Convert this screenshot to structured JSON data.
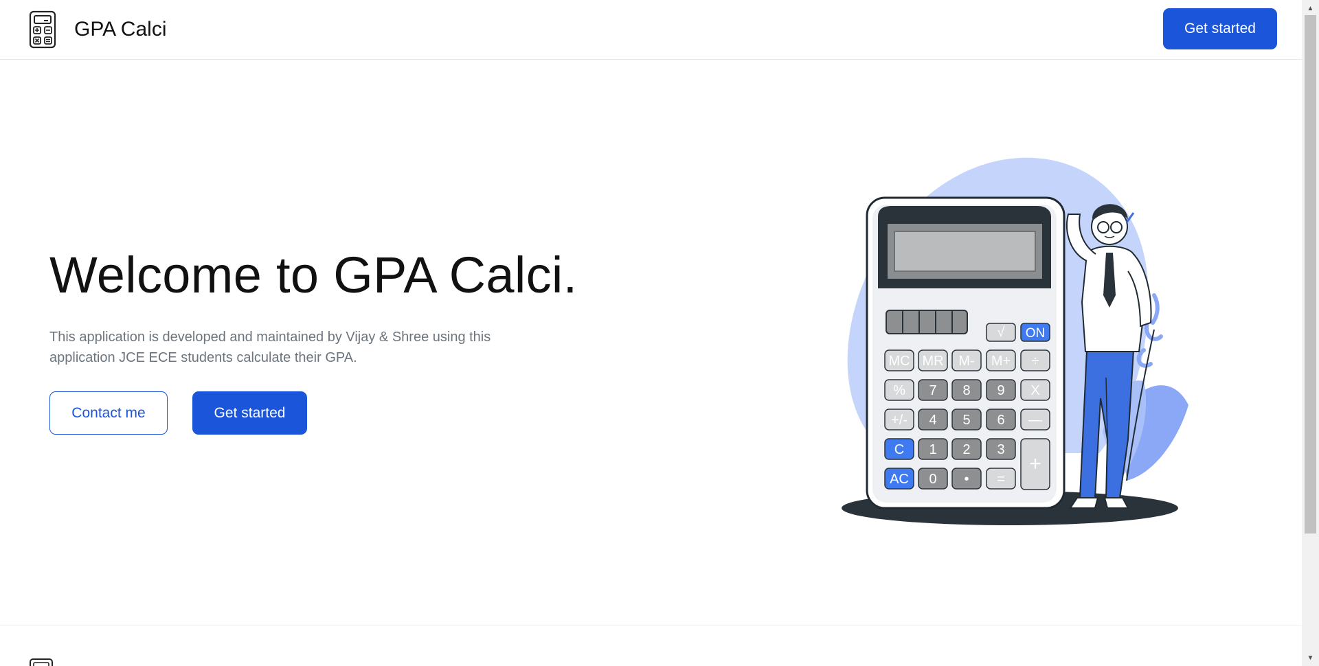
{
  "navbar": {
    "brand_name": "GPA Calci",
    "logo_icon": "calculator-icon",
    "cta_label": "Get started"
  },
  "hero": {
    "title": "Welcome to GPA Calci.",
    "description": "This application is developed and maintained by Vijay & Shree using this application JCE ECE students calculate their GPA.",
    "contact_label": "Contact me",
    "cta_label": "Get started"
  },
  "illustration": {
    "icon": "man-leaning-on-calculator-illustration",
    "keys_row1": [
      "√",
      "ON"
    ],
    "keys_row2": [
      "MC",
      "MR",
      "M-",
      "M+",
      "÷"
    ],
    "keys_row3": [
      "%",
      "7",
      "8",
      "9",
      "X"
    ],
    "keys_row4": [
      "+/-",
      "4",
      "5",
      "6",
      "—"
    ],
    "keys_row5": [
      "C",
      "1",
      "2",
      "3",
      "+"
    ],
    "keys_row6": [
      "AC",
      "0",
      "•",
      "="
    ]
  },
  "theme": {
    "primary": "#1b55d9",
    "text_muted": "#6c757d",
    "accent_light": "#c5d4fb"
  }
}
